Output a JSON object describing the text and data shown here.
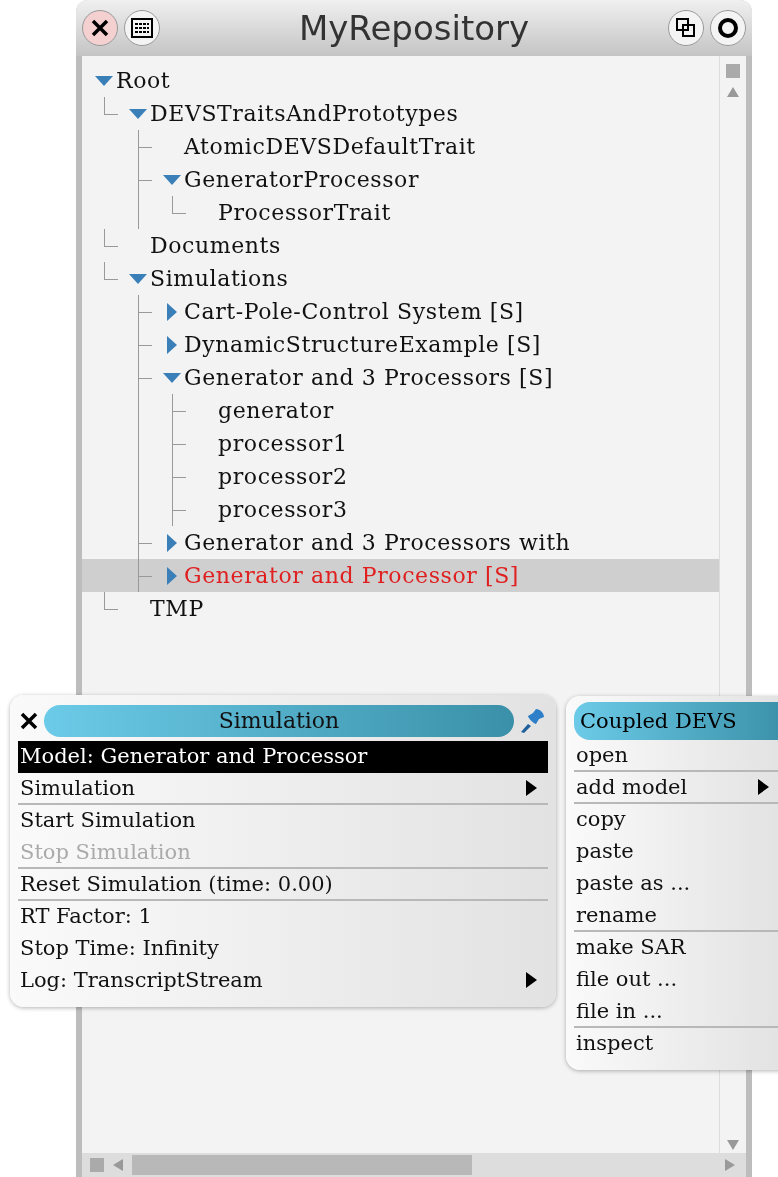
{
  "window": {
    "title": "MyRepository"
  },
  "tree": [
    {
      "label": "Root",
      "expanded": true,
      "selected": false,
      "children": [
        {
          "label": "DEVSTraitsAndPrototypes",
          "expanded": true,
          "selected": false,
          "children": [
            {
              "label": "AtomicDEVSDefaultTrait",
              "selected": false
            },
            {
              "label": "GeneratorProcessor",
              "expanded": true,
              "selected": false,
              "children": [
                {
                  "label": "ProcessorTrait",
                  "selected": false
                }
              ]
            }
          ]
        },
        {
          "label": "Documents",
          "selected": false
        },
        {
          "label": "Simulations",
          "expanded": true,
          "selected": false,
          "children": [
            {
              "label": "Cart-Pole-Control System [S]",
              "expanded": false,
              "selected": false
            },
            {
              "label": "DynamicStructureExample [S]",
              "expanded": false,
              "selected": false
            },
            {
              "label": "Generator and 3 Processors [S]",
              "expanded": true,
              "selected": false,
              "children": [
                {
                  "label": "generator",
                  "selected": false
                },
                {
                  "label": "processor1",
                  "selected": false
                },
                {
                  "label": "processor2",
                  "selected": false
                },
                {
                  "label": "processor3",
                  "selected": false
                }
              ]
            },
            {
              "label": "Generator and 3 Processors with",
              "expanded": false,
              "selected": false
            },
            {
              "label": "Generator and Processor [S]",
              "expanded": false,
              "selected": true
            }
          ]
        },
        {
          "label": "TMP",
          "selected": false
        }
      ]
    }
  ],
  "simulation_menu": {
    "title": "Simulation",
    "items": [
      {
        "label": "Model: Generator and Processor",
        "selected": true,
        "disabled": false,
        "submenu": false,
        "separator_after": false
      },
      {
        "label": "Simulation",
        "selected": false,
        "disabled": false,
        "submenu": true,
        "separator_after": true
      },
      {
        "label": "Start Simulation",
        "selected": false,
        "disabled": false,
        "submenu": false,
        "separator_after": false
      },
      {
        "label": "Stop Simulation",
        "selected": false,
        "disabled": true,
        "submenu": false,
        "separator_after": true
      },
      {
        "label": "Reset Simulation (time: 0.00)",
        "selected": false,
        "disabled": false,
        "submenu": false,
        "separator_after": true
      },
      {
        "label": "RT Factor: 1",
        "selected": false,
        "disabled": false,
        "submenu": false,
        "separator_after": false
      },
      {
        "label": "Stop Time: Infinity",
        "selected": false,
        "disabled": false,
        "submenu": false,
        "separator_after": false
      },
      {
        "label": "Log: TranscriptStream",
        "selected": false,
        "disabled": false,
        "submenu": true,
        "separator_after": false
      }
    ]
  },
  "context_menu": {
    "title": "Coupled DEVS",
    "items": [
      {
        "label": "open",
        "submenu": false,
        "separator_after": true
      },
      {
        "label": "add model",
        "submenu": true,
        "separator_after": true
      },
      {
        "label": "copy",
        "submenu": false,
        "separator_after": false
      },
      {
        "label": "paste",
        "submenu": false,
        "separator_after": false
      },
      {
        "label": "paste as ...",
        "submenu": false,
        "separator_after": false
      },
      {
        "label": "rename",
        "submenu": false,
        "separator_after": true
      },
      {
        "label": "make SAR",
        "submenu": false,
        "separator_after": false
      },
      {
        "label": "file out ...",
        "submenu": false,
        "separator_after": false
      },
      {
        "label": "file in ...",
        "submenu": false,
        "separator_after": true
      },
      {
        "label": "inspect",
        "submenu": false,
        "separator_after": false
      }
    ]
  }
}
